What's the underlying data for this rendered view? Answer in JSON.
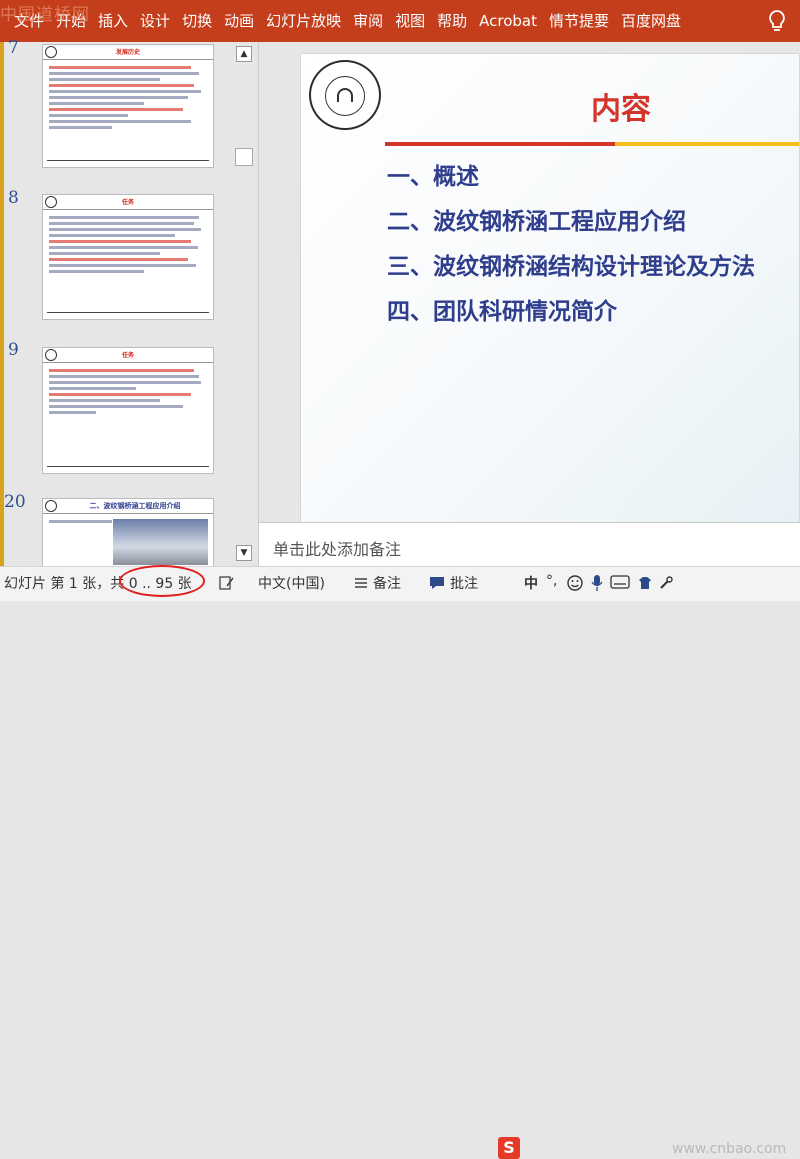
{
  "ribbon": {
    "tabs": [
      "文件",
      "开始",
      "插入",
      "设计",
      "切换",
      "动画",
      "幻灯片放映",
      "审阅",
      "视图",
      "帮助",
      "Acrobat",
      "情节提要",
      "百度网盘"
    ],
    "watermark": "中国道桥网"
  },
  "thumbnails": [
    {
      "number": "7",
      "title": "发展历史"
    },
    {
      "number": "8",
      "title": "任务"
    },
    {
      "number": "9",
      "title": "任务"
    },
    {
      "number": "20",
      "title": "二、波纹钢桥涵工程应用介绍"
    }
  ],
  "slide": {
    "title": "内容",
    "items": [
      "一、概述",
      "二、波纹钢桥涵工程应用介绍",
      "三、波纹钢桥涵结构设计理论及方法",
      "四、团队科研情况简介"
    ]
  },
  "notes": {
    "placeholder": "单击此处添加备注"
  },
  "status": {
    "slide_info": "幻灯片 第 1 张，共 0 .. 95 张",
    "language": "中文(中国)",
    "notes_btn": "备注",
    "comments_btn": "批注",
    "ime_label": "S",
    "ime_text": "中",
    "watermark": "www.cnbao.com"
  }
}
